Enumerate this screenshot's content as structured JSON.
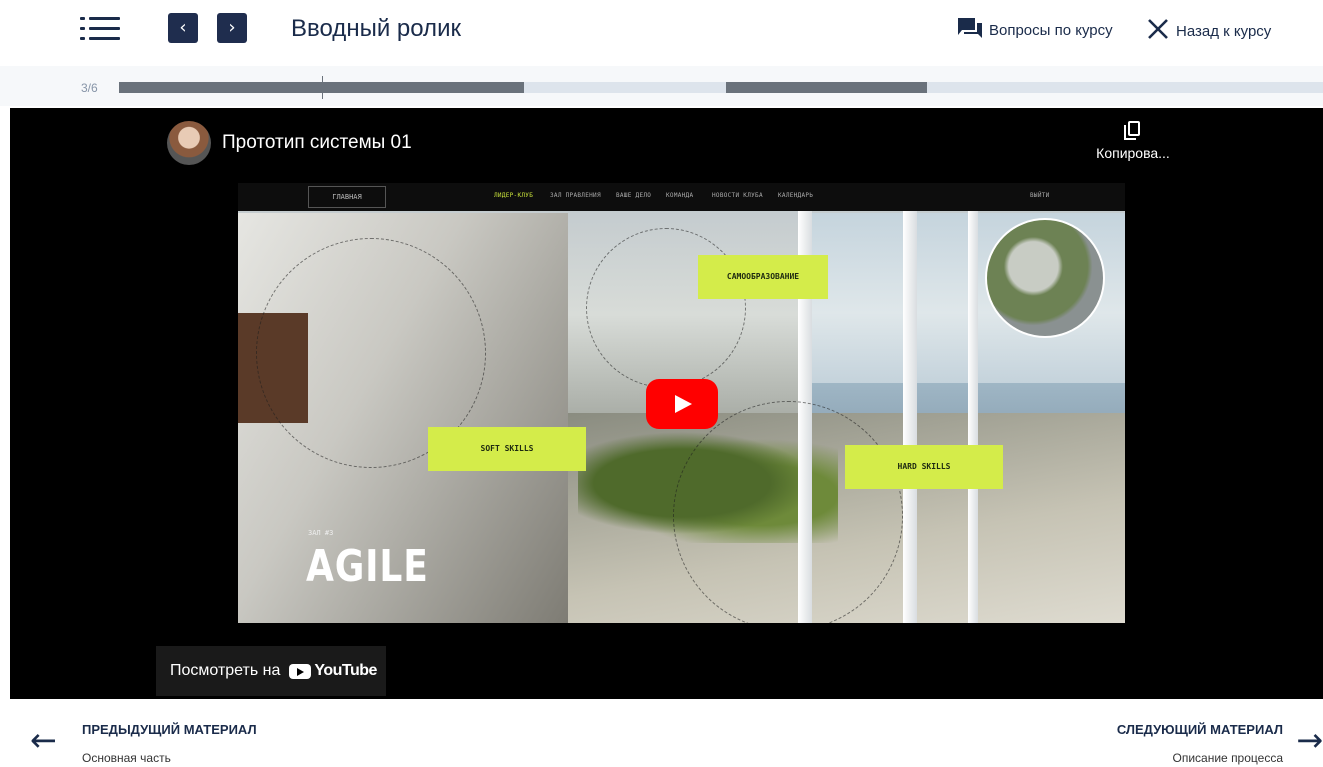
{
  "header": {
    "title": "Вводный ролик",
    "questions_label": "Вопросы по курсу",
    "back_label": "Назад к курсу",
    "menu_icon": "list-icon",
    "prev_icon": "chevron-left-icon",
    "next_icon": "chevron-right-icon"
  },
  "progress": {
    "label": "3/6",
    "current": 3,
    "total": 6
  },
  "video": {
    "channel_title": "Прототип системы 01",
    "copy_label": "Копирова...",
    "watch_on_label": "Посмотреть на",
    "youtube_word": "YouTube",
    "thumbnail": {
      "nav_home": "ГЛАВНАЯ",
      "nav_items": [
        "ЛИДЕР-КЛУБ",
        "ЗАЛ ПРАВЛЕНИЯ",
        "ВАШЕ ДЕЛО",
        "КОМАНДА",
        "НОВОСТИ КЛУБА",
        "КАЛЕНДАРЬ"
      ],
      "nav_exit": "ВЫЙТИ",
      "tag_self": "САМООБРАЗОВАНИЕ",
      "tag_soft": "SOFT SKILLS",
      "tag_hard": "HARD SKILLS",
      "zone_small": "ЗАЛ #3",
      "zone_big": "AGILE"
    }
  },
  "footer": {
    "prev_heading": "ПРЕДЫДУЩИЙ МАТЕРИАЛ",
    "prev_sub": "Основная часть",
    "next_heading": "СЛЕДУЮЩИЙ МАТЕРИАЛ",
    "next_sub": "Описание процесса"
  },
  "colors": {
    "navy": "#1a2b4a",
    "progress_done": "#6a727b",
    "progress_todo": "#dde4ec",
    "accent_green": "#d4ec4a",
    "youtube_red": "#ff0000"
  }
}
